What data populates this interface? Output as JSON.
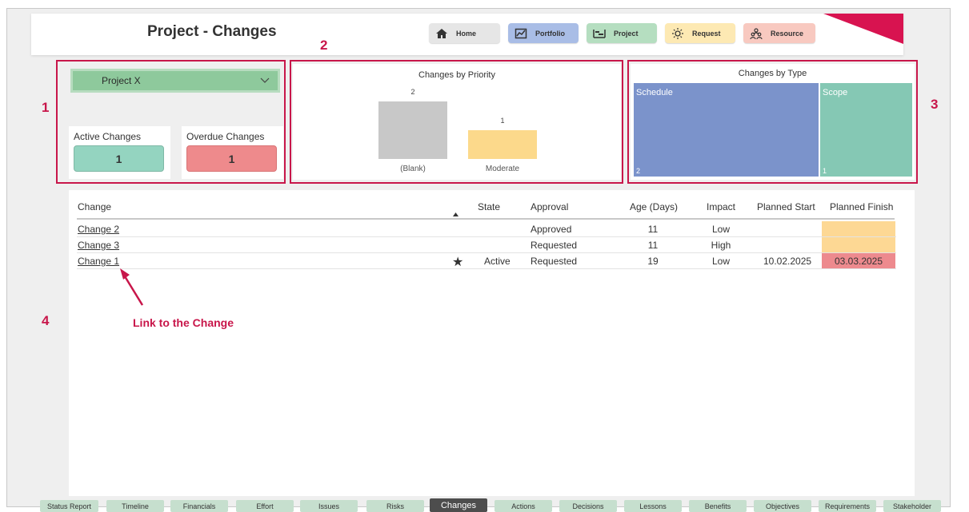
{
  "page_title": "Project - Changes",
  "nav": {
    "home": "Home",
    "portfolio": "Portfolio",
    "project": "Project",
    "request": "Request",
    "resource": "Resource"
  },
  "colors": {
    "accent": "#d81350",
    "annotation": "#c8164a",
    "home": "#e6e6e6",
    "portfolio": "#a9bde6",
    "project": "#b5dec0",
    "request": "#fde9b3",
    "resource": "#f8c9c0",
    "active_card": "#94d4c0",
    "overdue_card": "#ee8a8c",
    "bar_blank": "#c8c8c8",
    "bar_moderate": "#fcd98b",
    "schedule": "#7b93cb",
    "scope": "#85c8b4",
    "finish_warn": "#fdd894",
    "finish_overdue": "#ed8a8e"
  },
  "icons": {
    "home": "home-icon",
    "portfolio": "portfolio-icon",
    "project": "project-icon",
    "request": "lightbulb-icon",
    "resource": "people-icon",
    "dropdown": "chevron-down-icon",
    "star": "star-icon",
    "sort": "sort-ascending-icon"
  },
  "annotations": {
    "one": "1",
    "two": "2",
    "three": "3",
    "four": "4",
    "link_label": "Link to the Change"
  },
  "filter": {
    "project": "Project X"
  },
  "cards": {
    "active_label": "Active Changes",
    "active_value": "1",
    "overdue_label": "Overdue Changes",
    "overdue_value": "1"
  },
  "chart_data": [
    {
      "type": "bar",
      "title": "Changes by Priority",
      "categories": [
        "(Blank)",
        "Moderate"
      ],
      "values": [
        2,
        1
      ],
      "data_labels": [
        "2",
        "1"
      ],
      "ylim": [
        0,
        2
      ]
    },
    {
      "type": "treemap",
      "title": "Changes by Type",
      "categories": [
        "Schedule",
        "Scope"
      ],
      "values": [
        2,
        1
      ],
      "data_labels": [
        "2",
        "1"
      ]
    }
  ],
  "table": {
    "headers": {
      "change": "Change",
      "state": "State",
      "approval": "Approval",
      "age": "Age (Days)",
      "impact": "Impact",
      "planned_start": "Planned Start",
      "planned_finish": "Planned Finish"
    },
    "rows": [
      {
        "change": "Change 2",
        "star": false,
        "state": "",
        "approval": "Approved",
        "age": "11",
        "impact": "Low",
        "planned_start": "",
        "planned_finish": "",
        "finish_status": "warn"
      },
      {
        "change": "Change 3",
        "star": false,
        "state": "",
        "approval": "Requested",
        "age": "11",
        "impact": "High",
        "planned_start": "",
        "planned_finish": "",
        "finish_status": "warn"
      },
      {
        "change": "Change 1",
        "star": true,
        "state": "Active",
        "approval": "Requested",
        "age": "19",
        "impact": "Low",
        "planned_start": "10.02.2025",
        "planned_finish": "03.03.2025",
        "finish_status": "overdue"
      }
    ]
  },
  "tabs": [
    {
      "label": "Status Report",
      "active": false
    },
    {
      "label": "Timeline",
      "active": false
    },
    {
      "label": "Financials",
      "active": false
    },
    {
      "label": "Effort",
      "active": false
    },
    {
      "label": "Issues",
      "active": false
    },
    {
      "label": "Risks",
      "active": false
    },
    {
      "label": "Changes",
      "active": true
    },
    {
      "label": "Actions",
      "active": false
    },
    {
      "label": "Decisions",
      "active": false
    },
    {
      "label": "Lessons",
      "active": false
    },
    {
      "label": "Benefits",
      "active": false
    },
    {
      "label": "Objectives",
      "active": false
    },
    {
      "label": "Requirements",
      "active": false
    },
    {
      "label": "Stakeholder",
      "active": false
    }
  ]
}
